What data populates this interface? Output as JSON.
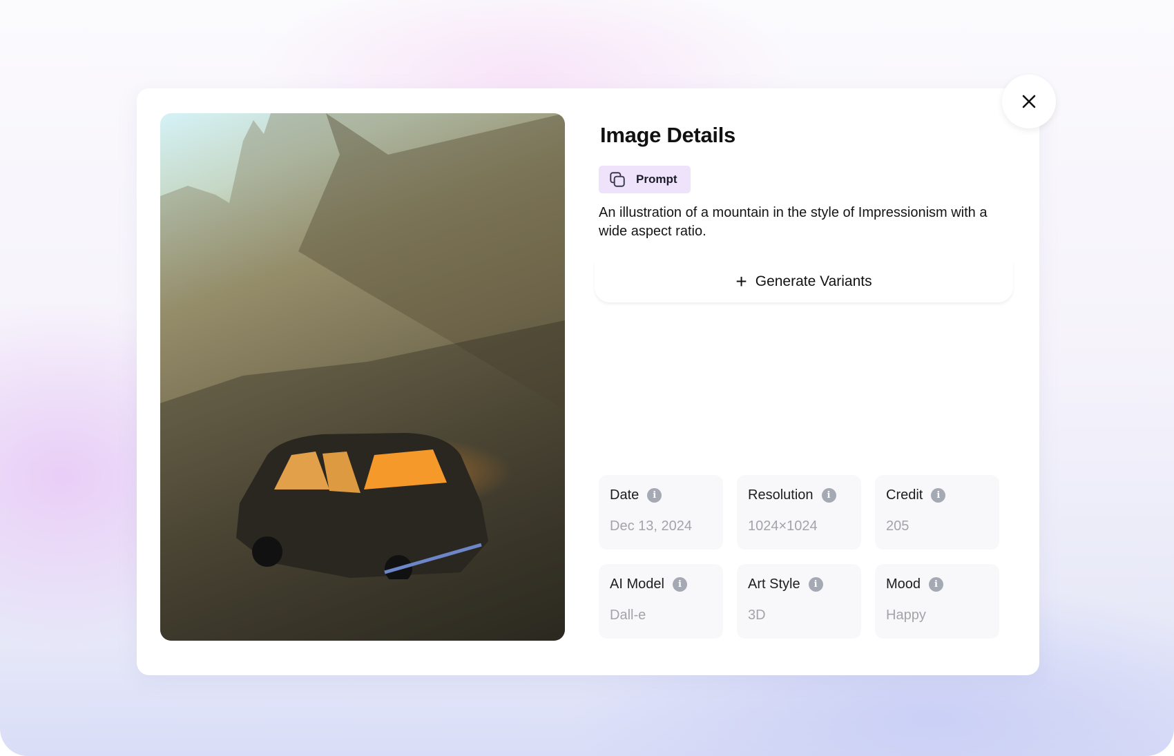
{
  "dialog": {
    "title": "Image Details",
    "prompt_label": "Prompt",
    "prompt_text": "An illustration of a mountain in the style of Impressionism with a wide aspect ratio.",
    "generate_label": "Generate Variants",
    "close_icon": "close-icon",
    "copy_icon": "copy-icon",
    "plus_icon": "plus-icon",
    "info_icon_glyph": "i",
    "image_alt": "Vintage car with glowing interior parked in a misty mountain valley"
  },
  "details": [
    {
      "label": "Date",
      "value": "Dec 13, 2024"
    },
    {
      "label": "Resolution",
      "value": "1024×1024"
    },
    {
      "label": "Credit",
      "value": "205"
    },
    {
      "label": "AI Model",
      "value": "Dall-e"
    },
    {
      "label": "Art Style",
      "value": "3D"
    },
    {
      "label": "Mood",
      "value": "Happy"
    }
  ],
  "colors": {
    "prompt_chip_bg": "#efe3fb",
    "card_bg": "#f8f8fa",
    "info_icon": "#a5a9b3",
    "value_text": "#a4a4a8"
  }
}
